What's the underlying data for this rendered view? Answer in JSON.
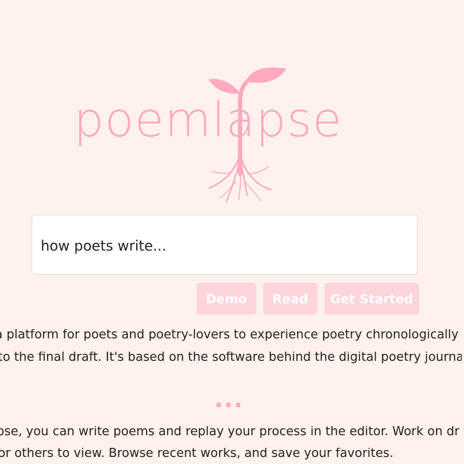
{
  "logo": {
    "wordmark": "poemlapse",
    "brand_color": "#ffa9bf"
  },
  "search": {
    "value": "how poets write..."
  },
  "buttons": {
    "demo": "Demo",
    "read": "Read",
    "get_started": "Get Started",
    "button_color": "#ffd5dc"
  },
  "intro": {
    "line1": "a platform for poets and poetry-lovers to experience poetry chronologically,",
    "line2": "to the final draft. It's based on the software behind the digital poetry journa",
    "separator": "...",
    "line3": "pse, you can write poems and replay your process in the editor. Work on dr",
    "line4": "or others to view. Browse recent works, and save your favorites."
  },
  "colors": {
    "background": "#fff1ec"
  }
}
